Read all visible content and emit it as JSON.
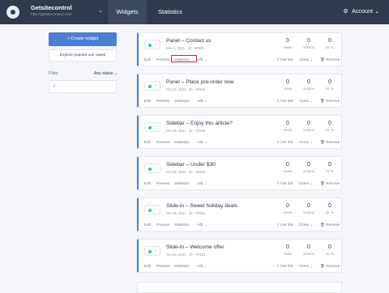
{
  "header": {
    "site_name": "Getsitecontrol",
    "site_url": "http://getsitecontrol.com",
    "tabs": [
      "Widgets",
      "Statistics"
    ],
    "account": "Account"
  },
  "sidebar": {
    "create_label": "+ Create widget",
    "explore_label": "Explore popular use cases",
    "filter_label": "Filter",
    "filter_status": "Any status",
    "search_placeholder": ""
  },
  "labels": {
    "views": "views",
    "actions": "actions",
    "ctr": "ctr %",
    "edit": "Edit",
    "preview": "Preview",
    "statistics": "Statistics",
    "ab": "A/B ⌄",
    "get_link": "Get link",
    "clone": "Clone ⌄",
    "remove": "Remove"
  },
  "widgets": [
    {
      "title": "Panel – Contact us",
      "date": "Nov 1, 2021",
      "id": "ID - 98340",
      "views": "0",
      "actions": "0",
      "ctr": "0"
    },
    {
      "title": "Panel – Place pre-order now",
      "date": "Oct 27, 2021",
      "id": "ID - 97942",
      "views": "0",
      "actions": "0",
      "ctr": "0"
    },
    {
      "title": "Sidebar – Enjoy this article?",
      "date": "Oct 26, 2021",
      "id": "ID - 97826",
      "views": "0",
      "actions": "0",
      "ctr": "0"
    },
    {
      "title": "Sidebar – Under $30",
      "date": "Oct 26, 2021",
      "id": "ID - 97825",
      "views": "0",
      "actions": "0",
      "ctr": "0"
    },
    {
      "title": "Slide-in – Sweet holiday deals",
      "date": "Oct 26, 2021",
      "id": "ID - 97824",
      "views": "0",
      "actions": "0",
      "ctr": "0"
    },
    {
      "title": "Slide-in – Welcome offer",
      "date": "Oct 26, 2021",
      "id": "ID - 97823",
      "views": "0",
      "actions": "0",
      "ctr": "0"
    }
  ],
  "colors": {
    "accent": "#4a7fd4",
    "header": "#2f3a4c",
    "active_toggle": "#2cbfa2",
    "highlight": "#c9212f"
  }
}
